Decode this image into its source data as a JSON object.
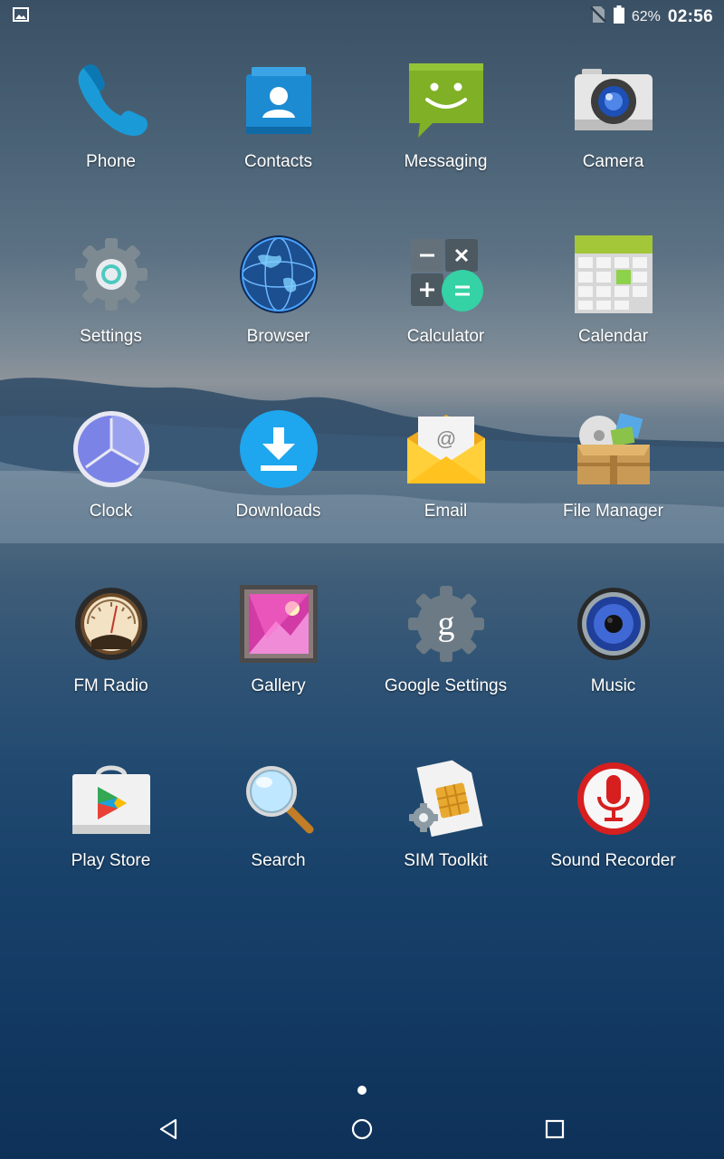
{
  "status": {
    "battery": "62%",
    "time": "02:56",
    "icons": [
      "image-notification-icon",
      "no-sim-icon",
      "battery-icon"
    ]
  },
  "apps": [
    {
      "label": "Phone",
      "icon": "phone-icon"
    },
    {
      "label": "Contacts",
      "icon": "contacts-icon"
    },
    {
      "label": "Messaging",
      "icon": "messaging-icon"
    },
    {
      "label": "Camera",
      "icon": "camera-icon"
    },
    {
      "label": "Settings",
      "icon": "settings-icon"
    },
    {
      "label": "Browser",
      "icon": "browser-icon"
    },
    {
      "label": "Calculator",
      "icon": "calculator-icon"
    },
    {
      "label": "Calendar",
      "icon": "calendar-icon"
    },
    {
      "label": "Clock",
      "icon": "clock-icon"
    },
    {
      "label": "Downloads",
      "icon": "downloads-icon"
    },
    {
      "label": "Email",
      "icon": "email-icon"
    },
    {
      "label": "File Manager",
      "icon": "file-manager-icon"
    },
    {
      "label": "FM Radio",
      "icon": "fm-radio-icon"
    },
    {
      "label": "Gallery",
      "icon": "gallery-icon"
    },
    {
      "label": "Google Settings",
      "icon": "google-settings-icon"
    },
    {
      "label": "Music",
      "icon": "music-icon"
    },
    {
      "label": "Play Store",
      "icon": "play-store-icon"
    },
    {
      "label": "Search",
      "icon": "search-icon"
    },
    {
      "label": "SIM Toolkit",
      "icon": "sim-toolkit-icon"
    },
    {
      "label": "Sound Recorder",
      "icon": "sound-recorder-icon"
    }
  ],
  "navigation": {
    "buttons": [
      "back-icon",
      "home-icon",
      "recents-icon"
    ]
  }
}
